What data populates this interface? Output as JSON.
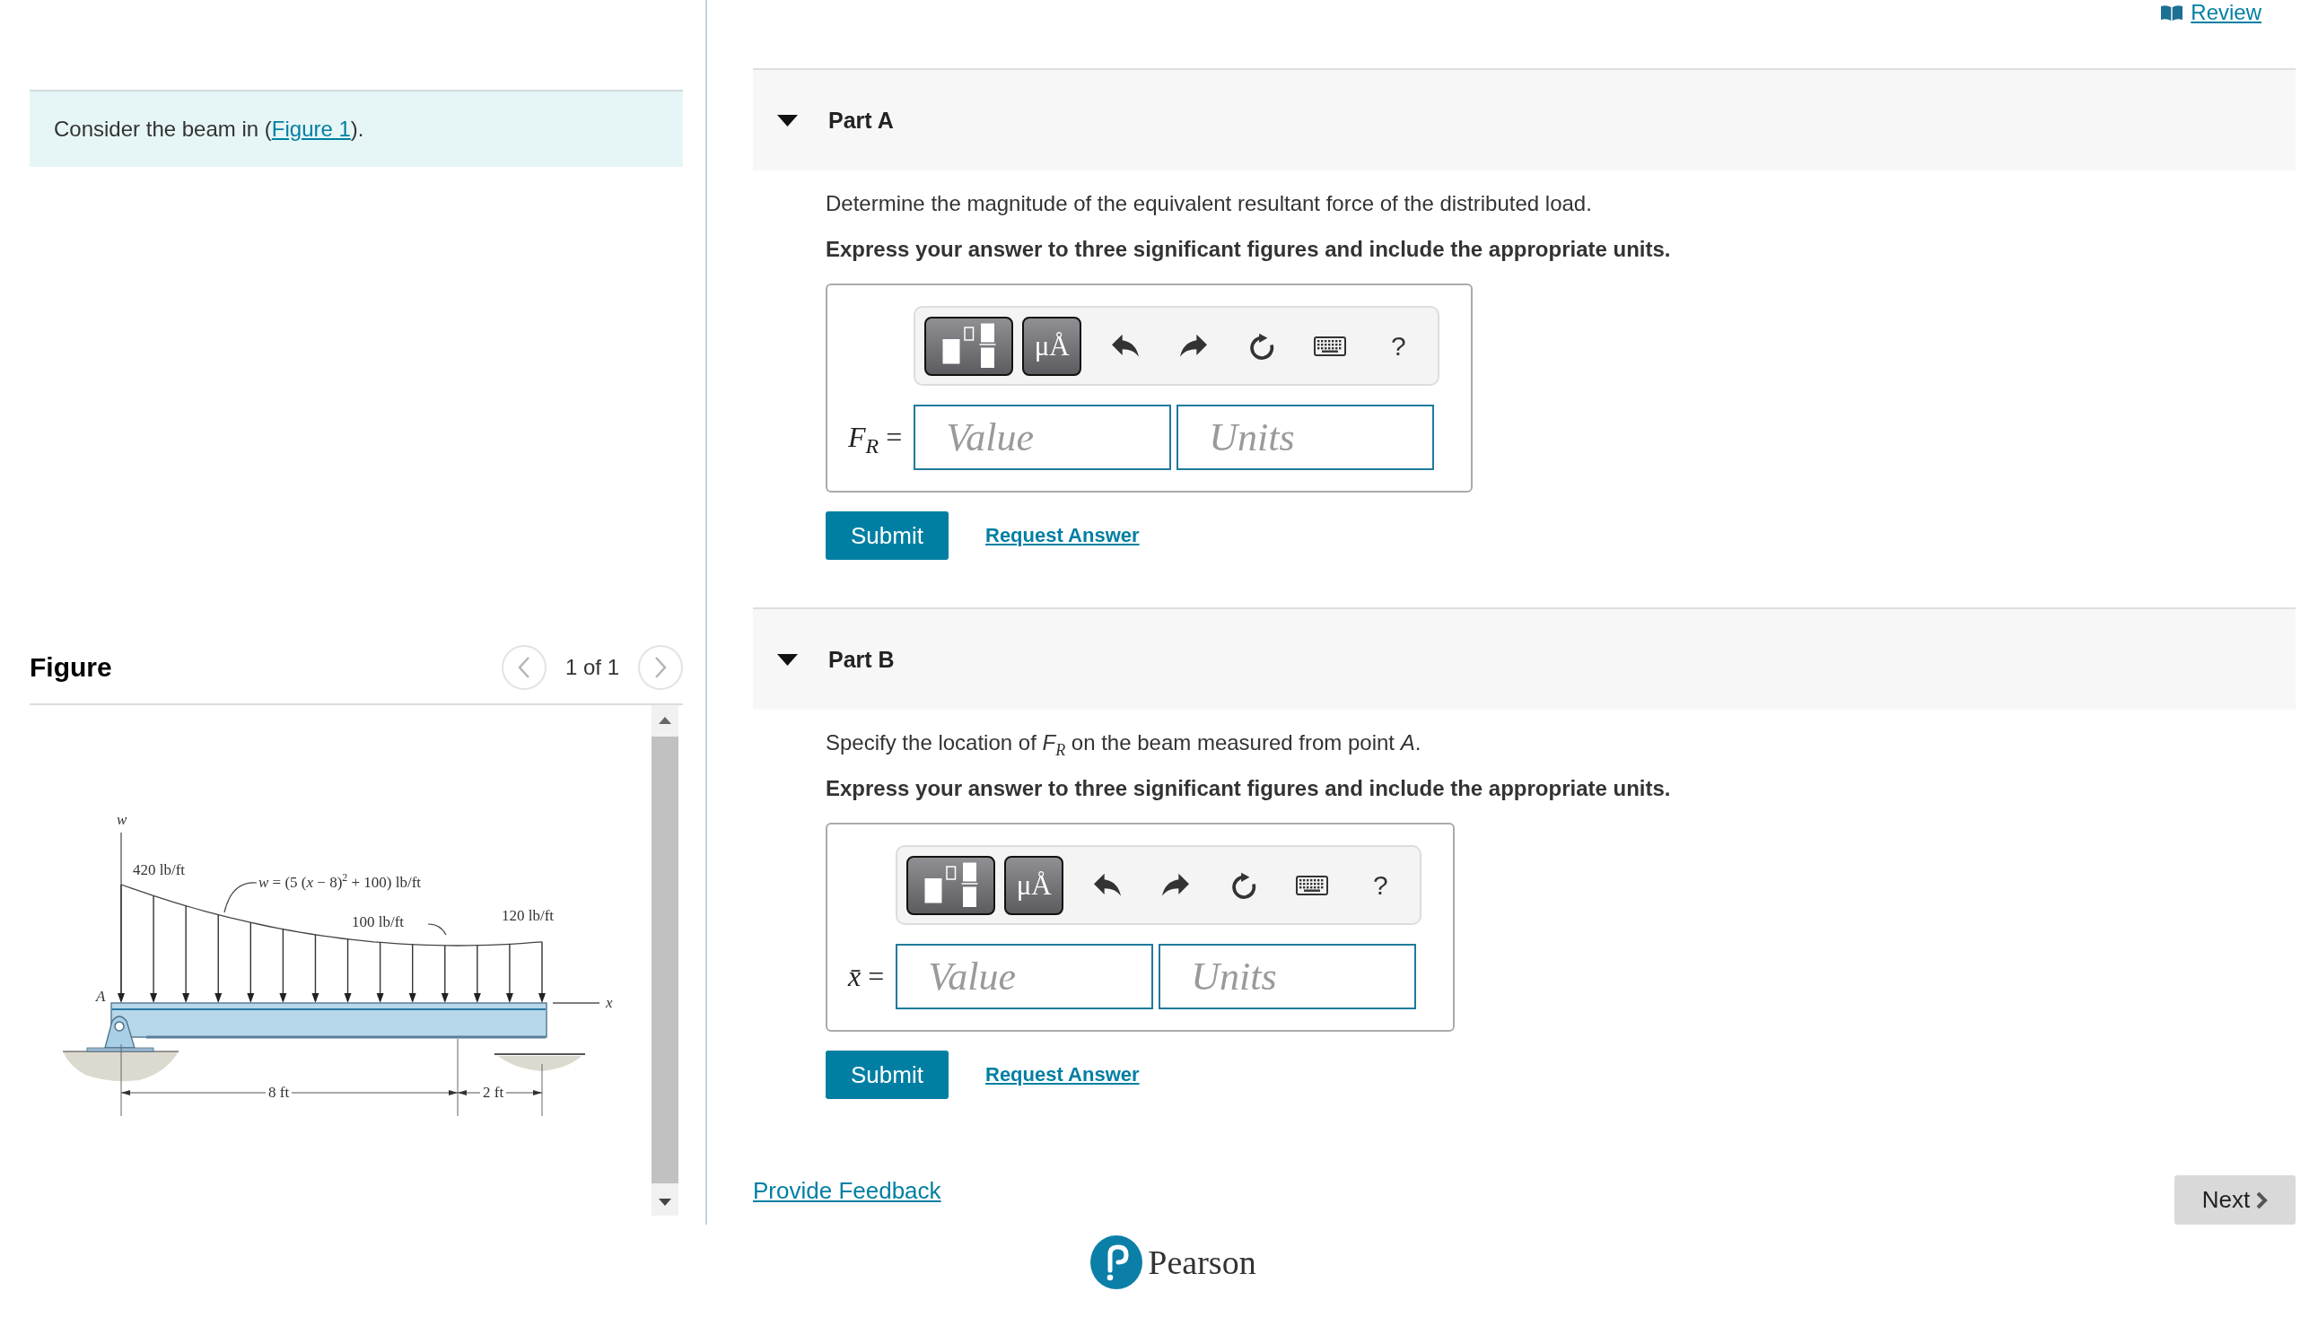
{
  "review_link": "Review",
  "intro": {
    "before": "Consider the beam in (",
    "link": "Figure 1",
    "after": ")."
  },
  "figure": {
    "title": "Figure",
    "prev_button": {
      "disabled": true
    },
    "pager": "1 of 1",
    "next_button": {
      "disabled": true
    },
    "labels": [
      {
        "kind": "variable",
        "text": "w"
      },
      {
        "kind": "load",
        "text": "420 lb/ft"
      },
      {
        "kind": "load",
        "text": "*w* = (5 (*x* − 8)$^{2}$ + 100) lb/ft"
      },
      {
        "kind": "load",
        "text": "100 lb/ft"
      },
      {
        "kind": "load",
        "text": "120 lb/ft"
      },
      {
        "kind": "variable",
        "text": "A"
      },
      {
        "kind": "variable",
        "text": "x"
      },
      {
        "kind": "dimension",
        "text": "8 ft"
      },
      {
        "kind": "dimension",
        "text": "2 ft"
      }
    ]
  },
  "parts": [
    {
      "title": "Part A",
      "expanded": true,
      "question": "Determine the magnitude of the equivalent resultant force of the distributed load.",
      "instruction": "Express your answer to three significant figures and include the appropriate units.",
      "toolbar": {
        "symbols": "μÅ",
        "help": "?"
      },
      "answer_label": "*F*$_{R}$ =",
      "value_field": {
        "placeholder": "Value"
      },
      "units_field": {
        "placeholder": "Units"
      },
      "submit": "Submit",
      "request_answer": "Request Answer"
    },
    {
      "title": "Part B",
      "expanded": true,
      "question": "Specify the location of *F*$_{R}$ on the beam measured from point *A*.",
      "instruction": "Express your answer to three significant figures and include the appropriate units.",
      "toolbar": {
        "symbols": "μÅ",
        "help": "?"
      },
      "answer_label": "*x̄* =",
      "value_field": {
        "placeholder": "Value"
      },
      "units_field": {
        "placeholder": "Units"
      },
      "submit": "Submit",
      "request_answer": "Request Answer"
    }
  ],
  "feedback_link": "Provide Feedback",
  "next_button": "Next",
  "footer": {
    "brand": "Pearson"
  }
}
